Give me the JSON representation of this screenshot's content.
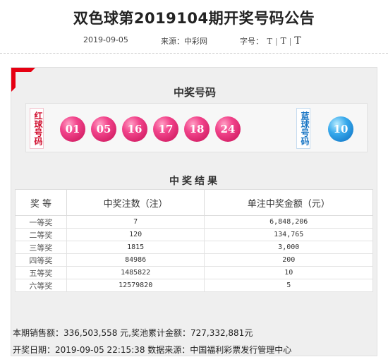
{
  "title": "双色球第2019104期开奖号码公告",
  "meta": {
    "date": "2019-09-05",
    "source": "来源：中彩网",
    "font_size_label": "字号：",
    "font_size_options": [
      "T",
      "T",
      "T"
    ]
  },
  "draw": {
    "heading": "中奖号码",
    "red_label": "红球号码",
    "blue_label": "蓝球号码",
    "red_balls": [
      "01",
      "05",
      "16",
      "17",
      "18",
      "24"
    ],
    "blue_ball": "10",
    "colors": {
      "accent": "#e60012",
      "red_ball": "#e8287c",
      "blue_ball": "#1a8ad8"
    }
  },
  "results": {
    "heading": "中奖结果",
    "columns": [
      "奖 等",
      "中奖注数（注）",
      "单注中奖金额（元）"
    ],
    "rows": [
      {
        "level": "一等奖",
        "count": "7",
        "amount": "6,848,206"
      },
      {
        "level": "二等奖",
        "count": "120",
        "amount": "134,765"
      },
      {
        "level": "三等奖",
        "count": "1815",
        "amount": "3,000"
      },
      {
        "level": "四等奖",
        "count": "84986",
        "amount": "200"
      },
      {
        "level": "五等奖",
        "count": "1485822",
        "amount": "10"
      },
      {
        "level": "六等奖",
        "count": "12579820",
        "amount": "5"
      }
    ]
  },
  "footer": {
    "sales_line": "本期销售额：336,503,558 元,奖池累计金额：727,332,881元",
    "date_line": "开奖日期：2019-09-05 22:15:38 数据来源：中国福利彩票发行管理中心"
  }
}
